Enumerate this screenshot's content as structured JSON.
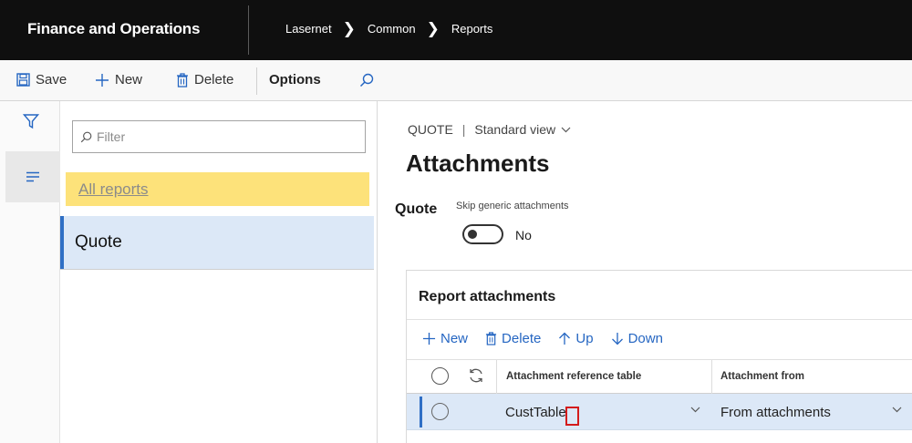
{
  "topbar": {
    "app_title": "Finance and Operations",
    "breadcrumbs": [
      "Lasernet",
      "Common",
      "Reports"
    ]
  },
  "actions": {
    "save": "Save",
    "new": "New",
    "delete": "Delete",
    "options": "Options"
  },
  "list": {
    "filter_placeholder": "Filter",
    "items": [
      "All reports",
      "Quote"
    ]
  },
  "detail": {
    "record": "QUOTE",
    "view": "Standard view",
    "title": "Attachments",
    "group_label": "Quote",
    "skip_label": "Skip generic attachments",
    "skip_value": "No",
    "fasttab_title": "Report attachments",
    "grid_actions": [
      "New",
      "Delete",
      "Up",
      "Down"
    ],
    "columns": [
      "Attachment reference table",
      "Attachment from"
    ],
    "rows": [
      {
        "reference_table": "CustTable",
        "attachment_from": "From attachments"
      }
    ]
  },
  "colors": {
    "topbar_bg": "#0f0f0f",
    "accent_blue": "#2566c2",
    "selection_bg": "#dce8f7",
    "all_reports_bg": "#fde27a",
    "cursor_highlight": "#d41b1b"
  }
}
